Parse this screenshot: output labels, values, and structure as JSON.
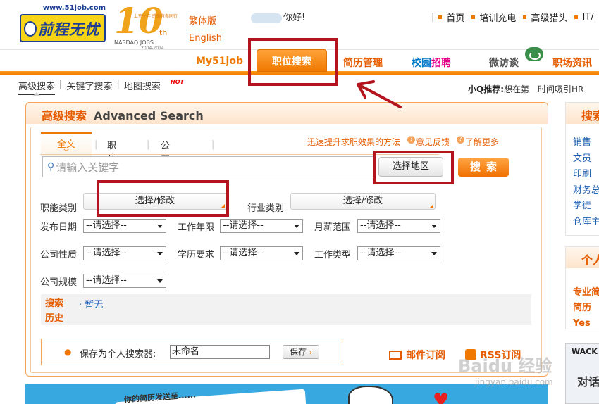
{
  "header": {
    "logo": {
      "url_text": "www.51job.com",
      "name": "前程无忧"
    },
    "anniversary": {
      "number": "10",
      "suffix": "th",
      "mini": "上市十年  感谢有你同行",
      "exchange": "NASDAQ:JOBS",
      "years": "2004-2014"
    },
    "lang_traditional": "繁体版",
    "lang_english": "English",
    "greeting": "你好!",
    "top_links": [
      "首页",
      "培训充电",
      "高级猎头",
      "IT/"
    ]
  },
  "main_nav": [
    "My51job",
    "职位搜索",
    "简历管理",
    "校园",
    "招聘",
    "微访谈",
    "职场资讯"
  ],
  "sub_nav": {
    "items": [
      "高级搜索",
      "关键字搜索",
      "地图搜索"
    ],
    "hot": "HOT"
  },
  "promo": {
    "label": "小Q推荐:",
    "text": "想在第一时间吸引HR"
  },
  "search": {
    "title_cn": "高级搜索",
    "title_en": "Advanced Search",
    "tabs": [
      "全文",
      "职位名",
      "公司名"
    ],
    "links": [
      "迅速提升求职效果的方法",
      "意见反馈",
      "了解更多"
    ],
    "keyword_placeholder": "请输入关键字",
    "region_button": "选择地区",
    "search_button": "搜索",
    "job_category": {
      "label": "职能类别",
      "button": "选择/修改"
    },
    "industry": {
      "label": "行业类别",
      "button": "选择/修改"
    },
    "filters": {
      "post_date": {
        "label": "发布日期",
        "value": "--请选择--"
      },
      "work_years": {
        "label": "工作年限",
        "value": "--请选择--"
      },
      "salary": {
        "label": "月薪范围",
        "value": "--请选择--"
      },
      "company_type": {
        "label": "公司性质",
        "value": "--请选择--"
      },
      "education": {
        "label": "学历要求",
        "value": "--请选择--"
      },
      "job_type": {
        "label": "工作类型",
        "value": "--请选择--"
      },
      "company_size": {
        "label": "公司规模",
        "value": "--请选择--"
      }
    },
    "history": {
      "label": "搜索历史",
      "value": "· 暂无"
    },
    "save": {
      "label": "保存为个人搜索器:",
      "value": "未命名",
      "button": "保存"
    },
    "subscribe": {
      "mail": "邮件订阅",
      "rss": "RSS订阅"
    }
  },
  "right_panel": {
    "box1": {
      "title": "搜索",
      "items": [
        "销售",
        "文员",
        "印刷",
        "财务总",
        "学徒",
        "仓库主"
      ]
    },
    "box2": {
      "title": "个人",
      "items": [
        "专业简",
        "简历Yes"
      ]
    },
    "box3": {
      "brand": "WACK",
      "text": "对话"
    }
  },
  "banner": {
    "text": "你的简历发送至......"
  },
  "watermark": {
    "text": "Baidu 经验",
    "url": "jingyan.baidu.com"
  },
  "colors": {
    "accent": "#f07800",
    "annotation": "#b4141e",
    "link": "#1c5fb0"
  }
}
